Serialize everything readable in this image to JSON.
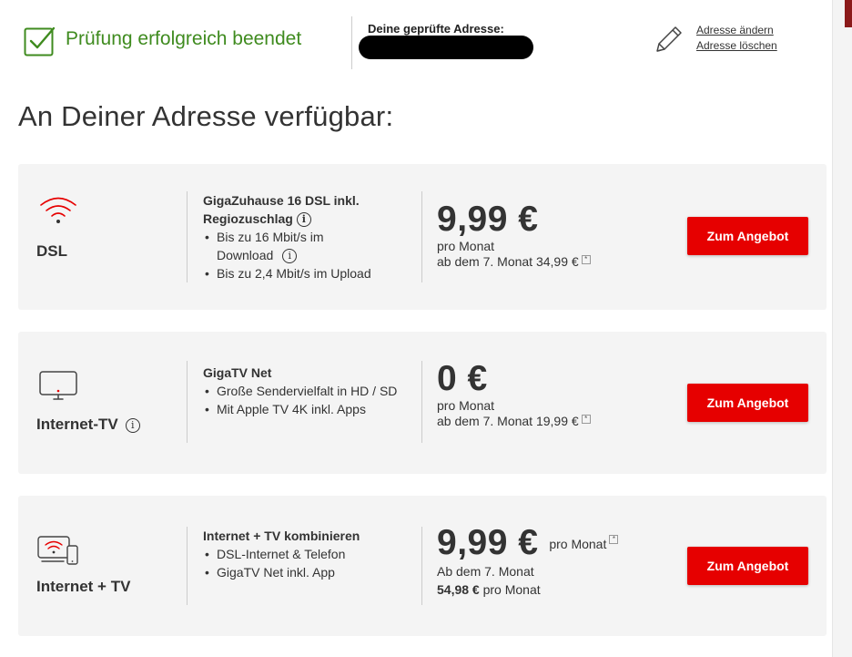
{
  "status": {
    "message": "Prüfung erfolgreich beendet",
    "address_label": "Deine geprüfte Adresse:",
    "change_link": "Adresse ändern",
    "delete_link": "Adresse löschen"
  },
  "heading": "An Deiner Adresse verfügbar:",
  "colors": {
    "accent_red": "#e60000",
    "success_green": "#3f8b1f",
    "card_bg": "#f4f4f4"
  },
  "offers": [
    {
      "product": "DSL",
      "icon": "wifi-icon",
      "feature_title_line1": "GigaZuhause 16 DSL inkl.",
      "feature_title_line2": "Regiozuschlag",
      "features": [
        "Bis zu 16 Mbit/s im",
        "Download",
        "Bis zu 2,4 Mbit/s im Upload"
      ],
      "price": "9,99 €",
      "price_unit": "pro Monat",
      "price_note": "ab dem 7. Monat 34,99 €",
      "cta": "Zum Angebot"
    },
    {
      "product": "Internet-TV",
      "icon": "tv-icon",
      "feature_title": "GigaTV Net",
      "features": [
        "Große Sendervielfalt in HD / SD",
        "Mit Apple TV 4K inkl. Apps"
      ],
      "price": "0 €",
      "price_unit": "pro Monat",
      "price_note": "ab dem 7. Monat 19,99 €",
      "cta": "Zum Angebot"
    },
    {
      "product": "Internet + TV",
      "icon": "devices-icon",
      "feature_title": "Internet + TV kombinieren",
      "features": [
        "DSL-Internet & Telefon",
        "GigaTV Net inkl. App"
      ],
      "price": "9,99 €",
      "price_unit": "pro Monat",
      "price_note": "Ab dem 7. Monat",
      "price_after": "54,98 €",
      "price_after_unit": "pro Monat",
      "cta": "Zum Angebot"
    }
  ],
  "star_symbol": "*",
  "info_symbol": "i"
}
